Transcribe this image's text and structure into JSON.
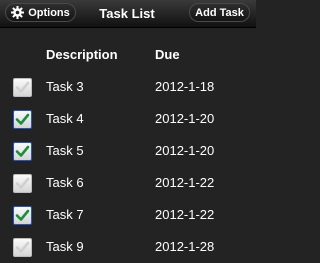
{
  "toolbar": {
    "options_label": "Options",
    "title": "Task List",
    "add_label": "Add Task"
  },
  "table": {
    "headers": {
      "description": "Description",
      "due": "Due"
    },
    "rows": [
      {
        "task": "Task 3",
        "due": "2012-1-18",
        "checked": false
      },
      {
        "task": "Task 4",
        "due": "2012-1-20",
        "checked": true
      },
      {
        "task": "Task 5",
        "due": "2012-1-20",
        "checked": true
      },
      {
        "task": "Task 6",
        "due": "2012-1-22",
        "checked": false
      },
      {
        "task": "Task 7",
        "due": "2012-1-22",
        "checked": true
      },
      {
        "task": "Task 9",
        "due": "2012-1-28",
        "checked": false
      }
    ]
  },
  "colors": {
    "background": "#232323",
    "check_on": "#1a8f3a",
    "check_off": "#d0d0d0",
    "checkbox_border_on": "#2255cc"
  }
}
